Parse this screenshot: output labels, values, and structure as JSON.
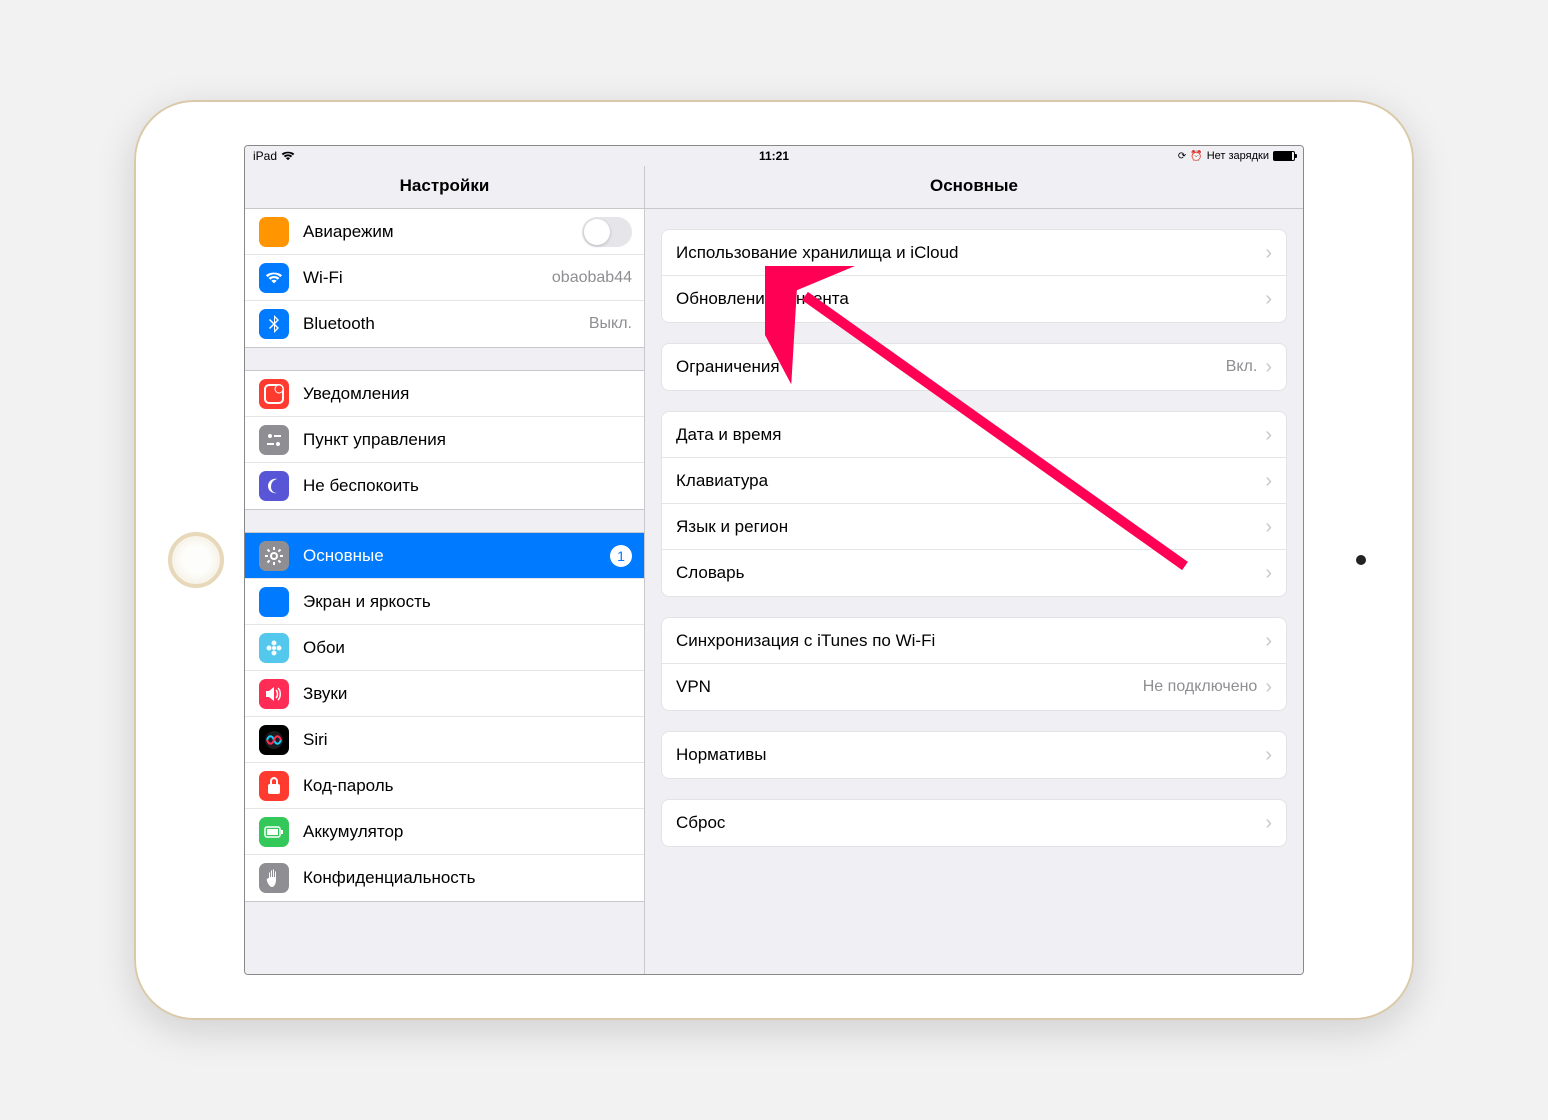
{
  "status": {
    "device": "iPad",
    "time": "11:21",
    "charge": "Нет зарядки"
  },
  "sidebar": {
    "title": "Настройки",
    "groups": [
      {
        "rows": [
          {
            "name": "airplane",
            "icon_bg": "#ff9500",
            "label": "Авиарежим",
            "toggle": true
          },
          {
            "name": "wifi",
            "icon_bg": "#007aff",
            "label": "Wi-Fi",
            "value": "obaobab44"
          },
          {
            "name": "bluetooth",
            "icon_bg": "#007aff",
            "label": "Bluetooth",
            "value": "Выкл."
          }
        ]
      },
      {
        "rows": [
          {
            "name": "notifications",
            "icon_bg": "#ff3b30",
            "label": "Уведомления"
          },
          {
            "name": "control-center",
            "icon_bg": "#8e8e93",
            "label": "Пункт управления"
          },
          {
            "name": "dnd",
            "icon_bg": "#5856d6",
            "label": "Не беспокоить"
          }
        ]
      },
      {
        "rows": [
          {
            "name": "general",
            "icon_bg": "#8e8e93",
            "label": "Основные",
            "badge": "1",
            "selected": true
          },
          {
            "name": "display",
            "icon_bg": "#007aff",
            "label": "Экран и яркость"
          },
          {
            "name": "wallpaper",
            "icon_bg": "#54c7ec",
            "label": "Обои"
          },
          {
            "name": "sounds",
            "icon_bg": "#ff2d55",
            "label": "Звуки"
          },
          {
            "name": "siri",
            "icon_bg": "#1c1c1e",
            "label": "Siri"
          },
          {
            "name": "passcode",
            "icon_bg": "#ff3b30",
            "label": "Код-пароль"
          },
          {
            "name": "battery",
            "icon_bg": "#34c759",
            "label": "Аккумулятор"
          },
          {
            "name": "privacy",
            "icon_bg": "#8e8e93",
            "label": "Конфиденциальность"
          }
        ]
      }
    ]
  },
  "detail": {
    "title": "Основные",
    "groups": [
      {
        "rows": [
          {
            "name": "storage",
            "label": "Использование хранилища и iCloud"
          },
          {
            "name": "background-refresh",
            "label": "Обновление контента"
          }
        ]
      },
      {
        "rows": [
          {
            "name": "restrictions",
            "label": "Ограничения",
            "value": "Вкл."
          }
        ]
      },
      {
        "rows": [
          {
            "name": "datetime",
            "label": "Дата и время"
          },
          {
            "name": "keyboard",
            "label": "Клавиатура"
          },
          {
            "name": "language",
            "label": "Язык и регион"
          },
          {
            "name": "dictionary",
            "label": "Словарь"
          }
        ]
      },
      {
        "rows": [
          {
            "name": "itunes-sync",
            "label": "Синхронизация с iTunes по Wi-Fi"
          },
          {
            "name": "vpn",
            "label": "VPN",
            "value": "Не подключено"
          }
        ]
      },
      {
        "rows": [
          {
            "name": "regulatory",
            "label": "Нормативы"
          }
        ]
      },
      {
        "rows": [
          {
            "name": "reset",
            "label": "Сброс"
          }
        ]
      }
    ]
  },
  "icons": {
    "airplane": "✈",
    "wifi": "wifi",
    "bluetooth": "bt",
    "notifications": "notif",
    "control-center": "cc",
    "dnd": "moon",
    "general": "gear",
    "display": "AA",
    "wallpaper": "flower",
    "sounds": "speaker",
    "siri": "siri",
    "passcode": "lock",
    "battery": "batt",
    "privacy": "hand"
  }
}
